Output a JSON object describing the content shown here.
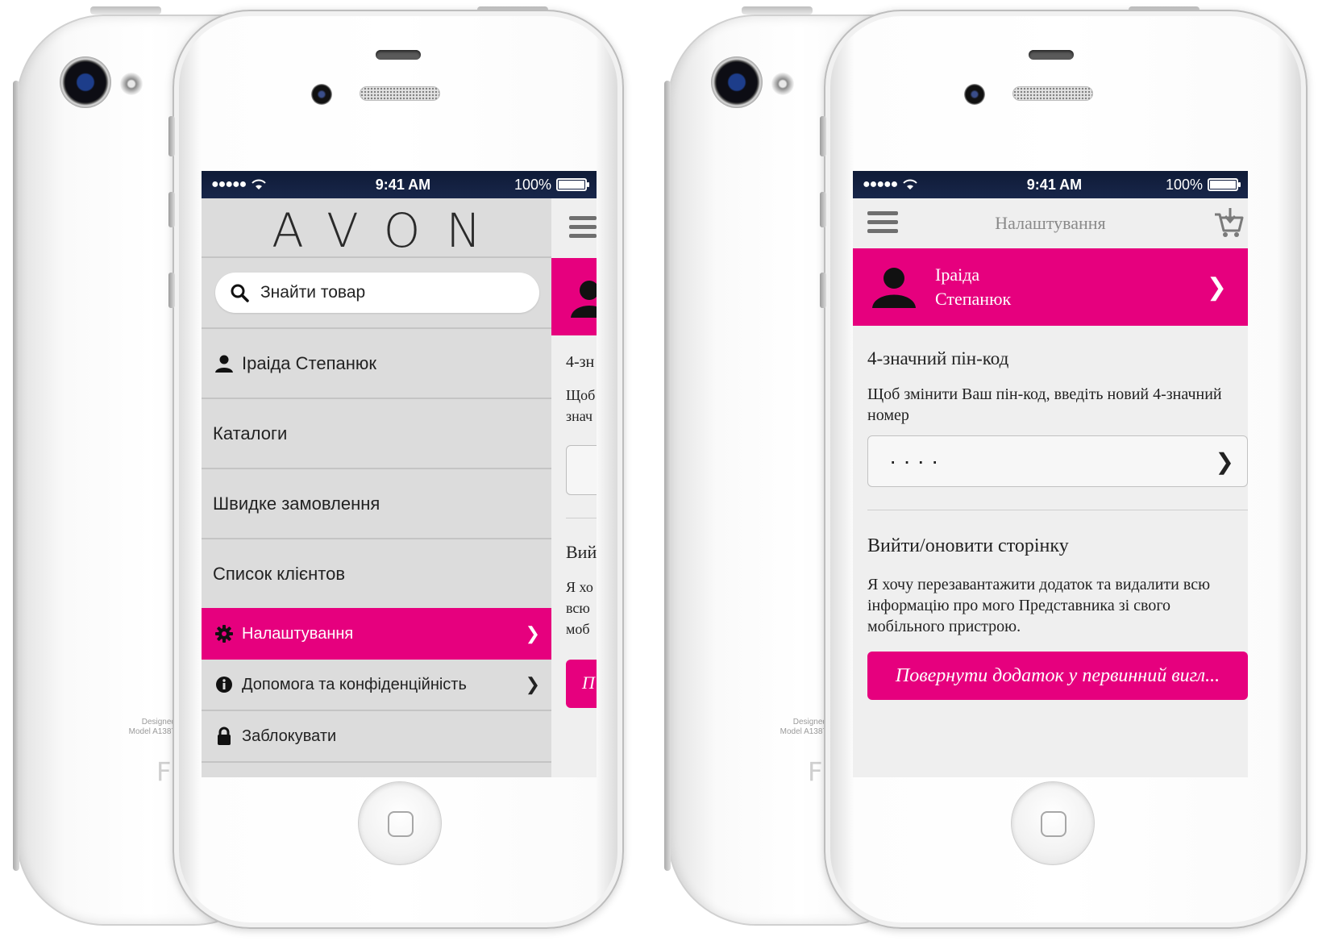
{
  "colors": {
    "accent": "#e6007e",
    "status_bar": "#0f1b37",
    "drawer_bg": "#dcdcdc",
    "content_bg": "#efefef"
  },
  "device": {
    "model_line1": "Designed",
    "model_line2": "Model A1387"
  },
  "statusbar": {
    "signal": "●●●●●",
    "time": "9:41 AM",
    "battery": "100%",
    "battery_level": 1.0
  },
  "left_screen": {
    "logo": "AVON",
    "search": {
      "icon": "search-icon",
      "placeholder": "Знайти товар"
    },
    "menu": {
      "profile": {
        "label": "Іраіда Степанюк",
        "icon": "user-icon"
      },
      "catalogs": {
        "label": "Каталоги"
      },
      "quick_order": {
        "label": "Швидке замовлення"
      },
      "clients": {
        "label": "Список клієнтов"
      },
      "settings": {
        "label": "Налаштування",
        "icon": "gear-icon",
        "active": true
      },
      "help": {
        "label": "Допомога та конфіденційність",
        "icon": "info-icon"
      },
      "lock": {
        "label": "Заблокувати",
        "icon": "lock-icon"
      }
    },
    "peek": {
      "t1": "4-зн",
      "t2": "Щоб",
      "t3": "знач",
      "t4": "Вий",
      "t5": "Я хо",
      "t6": "всю",
      "t7": "моб",
      "t8": "П"
    }
  },
  "right_screen": {
    "title": "Налаштування",
    "profile": {
      "first_name": "Іраіда",
      "last_name": "Степанюк"
    },
    "pin_section": {
      "title": "4-значний пін-код",
      "description": "Щоб змінити Ваш пін-код, введіть новий 4-значний номер",
      "value": "····"
    },
    "reset_section": {
      "title": "Вийти/оновити сторінку",
      "description": "Я хочу перезавантажити додаток та видалити всю інформацію про мого Представника зі свого мобільного пристрою.",
      "button": "Повернути додаток у первинний вигл..."
    }
  }
}
